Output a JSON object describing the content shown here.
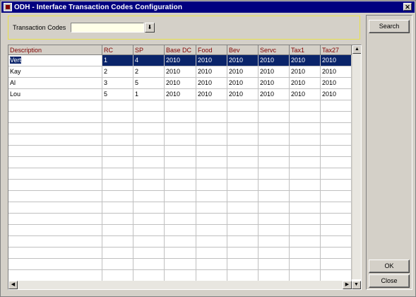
{
  "window": {
    "title": "ODH - Interface Transaction Codes Configuration",
    "close_glyph": "✕"
  },
  "filter": {
    "label": "Transaction Codes",
    "value": "",
    "dropdown_glyph": "⬇"
  },
  "grid": {
    "columns": [
      "Description",
      "RC",
      "SP",
      "Base DC",
      "Food",
      "Bev",
      "Servc",
      "Tax1",
      "Tax27"
    ],
    "rows": [
      [
        "Vert",
        "1",
        "4",
        "2010",
        "2010",
        "2010",
        "2010",
        "2010",
        "2010"
      ],
      [
        "Kay",
        "2",
        "2",
        "2010",
        "2010",
        "2010",
        "2010",
        "2010",
        "2010"
      ],
      [
        "Al",
        "3",
        "5",
        "2010",
        "2010",
        "2010",
        "2010",
        "2010",
        "2010"
      ],
      [
        "Lou",
        "5",
        "1",
        "2010",
        "2010",
        "2010",
        "2010",
        "2010",
        "2010"
      ]
    ],
    "selected_row": 0,
    "empty_rows": 16
  },
  "scroll": {
    "up": "▲",
    "down": "▼",
    "left": "◀",
    "right": "▶"
  },
  "buttons": {
    "search": "Search",
    "ok": "OK",
    "close": "Close"
  },
  "colors": {
    "titlebar": "#000080",
    "selection": "#0a246a",
    "header_text": "#800000",
    "filter_border": "#e8e04c"
  }
}
